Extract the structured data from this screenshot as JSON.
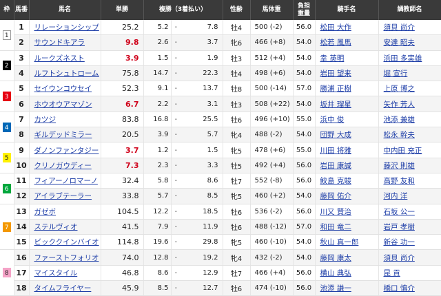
{
  "headers": {
    "waku": "枠",
    "uma": "馬番",
    "name": "馬名",
    "win": "単勝",
    "place": "複勝（3着払い）",
    "sex": "性齢",
    "bw": "馬体重",
    "weight_l1": "負担",
    "weight_l2": "重量",
    "jockey": "騎手名",
    "trainer": "調教師名"
  },
  "waku_colors": {
    "1": "#ffffff",
    "2": "#000000",
    "3": "#e60012",
    "4": "#0068b7",
    "5": "#fff100",
    "6": "#00a73c",
    "7": "#f39800",
    "8": "#f5a3c7"
  },
  "horses": [
    {
      "waku": "1",
      "num": "1",
      "name": "リレーションシップ",
      "win": "25.2",
      "pmin": "5.2",
      "pmax": "7.8",
      "sex": "牡4",
      "bw": "500 (-2)",
      "wt": "56.0",
      "jockey": "松田 大作",
      "trainer": "須貝 尚介",
      "fav": false
    },
    {
      "waku": "1",
      "num": "2",
      "name": "サウンドキアラ",
      "win": "9.8",
      "pmin": "2.6",
      "pmax": "3.7",
      "sex": "牝6",
      "bw": "466 (+8)",
      "wt": "54.0",
      "jockey": "松若 風馬",
      "trainer": "安達 昭夫",
      "fav": true
    },
    {
      "waku": "2",
      "num": "3",
      "name": "ルークズネスト",
      "win": "3.9",
      "pmin": "1.5",
      "pmax": "1.9",
      "sex": "牡3",
      "bw": "512 (+4)",
      "wt": "54.0",
      "jockey": "幸 英明",
      "trainer": "浜田 多実雄",
      "fav": true
    },
    {
      "waku": "2",
      "num": "4",
      "name": "ルフトシュトローム",
      "win": "75.8",
      "pmin": "14.7",
      "pmax": "22.3",
      "sex": "牡4",
      "bw": "498 (+6)",
      "wt": "54.0",
      "jockey": "岩田 望来",
      "trainer": "堀 宣行",
      "fav": false
    },
    {
      "waku": "3",
      "num": "5",
      "name": "セイウンコウセイ",
      "win": "52.3",
      "pmin": "9.1",
      "pmax": "13.7",
      "sex": "牡8",
      "bw": "500 (-14)",
      "wt": "57.0",
      "jockey": "勝浦 正樹",
      "trainer": "上原 博之",
      "fav": false
    },
    {
      "waku": "3",
      "num": "6",
      "name": "ホウオウアマゾン",
      "win": "6.7",
      "pmin": "2.2",
      "pmax": "3.1",
      "sex": "牡3",
      "bw": "508 (+22)",
      "wt": "54.0",
      "jockey": "坂井 瑠星",
      "trainer": "矢作 芳人",
      "fav": true
    },
    {
      "waku": "4",
      "num": "7",
      "name": "カツジ",
      "win": "83.8",
      "pmin": "16.8",
      "pmax": "25.5",
      "sex": "牡6",
      "bw": "496 (+10)",
      "wt": "55.0",
      "jockey": "浜中 俊",
      "trainer": "池添 兼雄",
      "fav": false
    },
    {
      "waku": "4",
      "num": "8",
      "name": "ギルデッドミラー",
      "win": "20.5",
      "pmin": "3.9",
      "pmax": "5.7",
      "sex": "牝4",
      "bw": "488 (-2)",
      "wt": "54.0",
      "jockey": "団野 大成",
      "trainer": "松永 幹夫",
      "fav": false
    },
    {
      "waku": "5",
      "num": "9",
      "name": "ダノンファンタジー",
      "win": "3.7",
      "pmin": "1.2",
      "pmax": "1.5",
      "sex": "牝5",
      "bw": "478 (+6)",
      "wt": "55.0",
      "jockey": "川田 将雅",
      "trainer": "中内田 充正",
      "fav": true
    },
    {
      "waku": "5",
      "num": "10",
      "name": "クリノガウディー",
      "win": "7.3",
      "pmin": "2.3",
      "pmax": "3.3",
      "sex": "牡5",
      "bw": "492 (+4)",
      "wt": "56.0",
      "jockey": "岩田 康誠",
      "trainer": "藤沢 則雄",
      "fav": true
    },
    {
      "waku": "6",
      "num": "11",
      "name": "フィアーノロマーノ",
      "win": "32.4",
      "pmin": "5.8",
      "pmax": "8.6",
      "sex": "牡7",
      "bw": "552 (-8)",
      "wt": "56.0",
      "jockey": "鮫島 克駿",
      "trainer": "高野 友和",
      "fav": false
    },
    {
      "waku": "6",
      "num": "12",
      "name": "アイラブテーラー",
      "win": "33.8",
      "pmin": "5.7",
      "pmax": "8.5",
      "sex": "牝5",
      "bw": "460 (+2)",
      "wt": "54.0",
      "jockey": "藤岡 佑介",
      "trainer": "河内 洋",
      "fav": false
    },
    {
      "waku": "7",
      "num": "13",
      "name": "ガゼボ",
      "win": "104.5",
      "pmin": "12.2",
      "pmax": "18.5",
      "sex": "牡6",
      "bw": "536 (-2)",
      "wt": "56.0",
      "jockey": "川又 賢治",
      "trainer": "石坂 公一",
      "fav": false
    },
    {
      "waku": "7",
      "num": "14",
      "name": "ステルヴィオ",
      "win": "41.5",
      "pmin": "7.9",
      "pmax": "11.9",
      "sex": "牡6",
      "bw": "488 (-12)",
      "wt": "57.0",
      "jockey": "和田 竜二",
      "trainer": "岩戸 孝樹",
      "fav": false
    },
    {
      "waku": "7",
      "num": "15",
      "name": "ビッククインバイオ",
      "win": "114.8",
      "pmin": "19.6",
      "pmax": "29.8",
      "sex": "牝5",
      "bw": "460 (-10)",
      "wt": "54.0",
      "jockey": "秋山 真一郎",
      "trainer": "新谷 功一",
      "fav": false
    },
    {
      "waku": "8",
      "num": "16",
      "name": "ファーストフォリオ",
      "win": "74.0",
      "pmin": "12.8",
      "pmax": "19.2",
      "sex": "牝4",
      "bw": "432 (-2)",
      "wt": "54.0",
      "jockey": "藤岡 康太",
      "trainer": "須貝 尚介",
      "fav": false
    },
    {
      "waku": "8",
      "num": "17",
      "name": "マイスタイル",
      "win": "46.8",
      "pmin": "8.6",
      "pmax": "12.9",
      "sex": "牡7",
      "bw": "466 (+4)",
      "wt": "56.0",
      "jockey": "横山 典弘",
      "trainer": "昆 貢",
      "fav": false
    },
    {
      "waku": "8",
      "num": "18",
      "name": "タイムフライヤー",
      "win": "45.9",
      "pmin": "8.5",
      "pmax": "12.7",
      "sex": "牡6",
      "bw": "474 (-10)",
      "wt": "56.0",
      "jockey": "池添 謙一",
      "trainer": "橋口 慎介",
      "fav": false
    }
  ]
}
